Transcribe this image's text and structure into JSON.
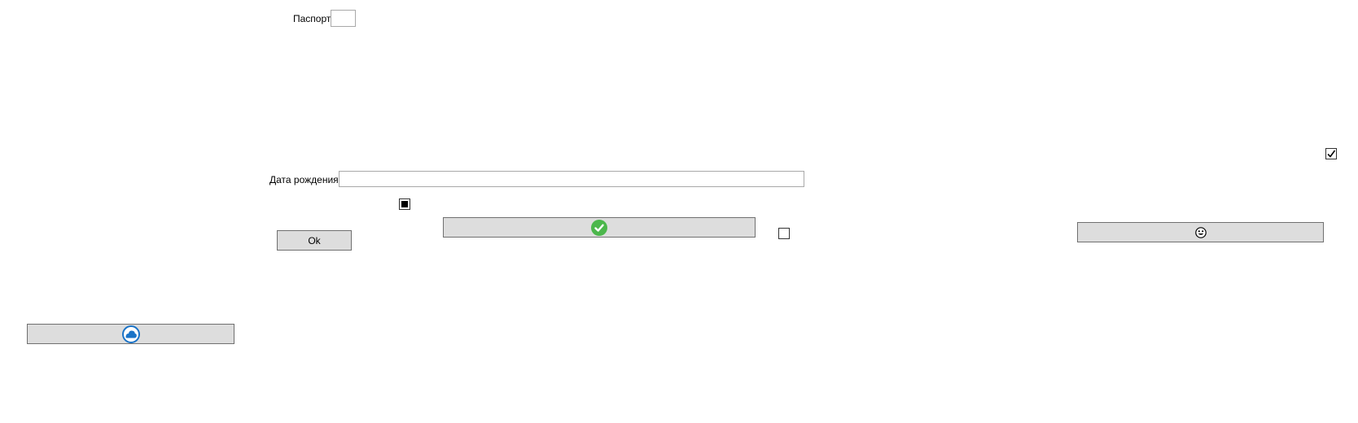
{
  "form": {
    "passport_label": "Паспорт",
    "passport_value": "",
    "birthdate_label": "Дата рождения",
    "birthdate_value": "",
    "ok_button_label": "Ok"
  },
  "checkboxes": {
    "top_right_checked": true,
    "indeterminate_state": "indeterminate",
    "unchecked": false
  },
  "icons": {
    "confirm_button_icon": "green-checkmark-icon",
    "smiley_button_icon": "smiley-face-icon",
    "cloud_button_icon": "blue-cloud-icon"
  },
  "colors": {
    "button_bg": "#dddddd",
    "button_border": "#707070",
    "check_green": "#4cb74c",
    "cloud_blue": "#1a73c7"
  }
}
